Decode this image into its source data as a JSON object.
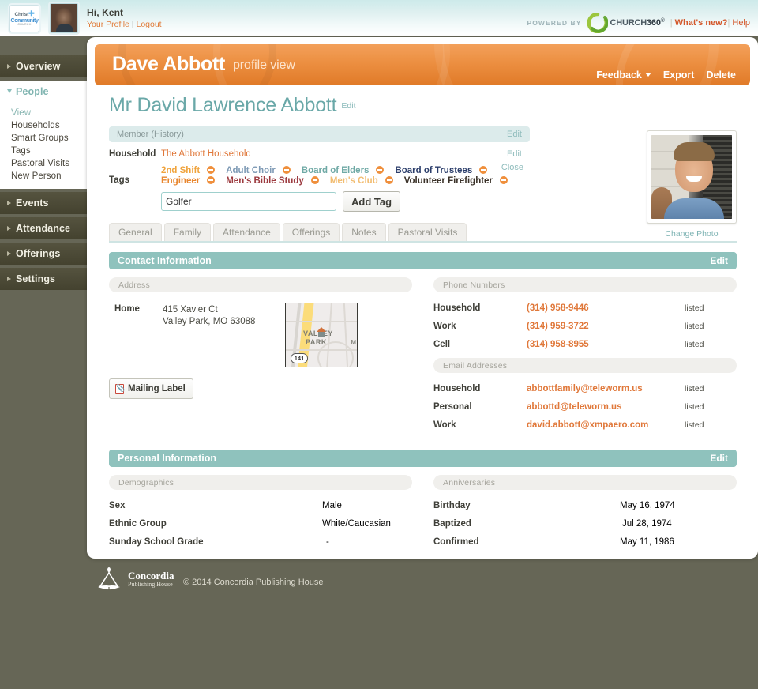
{
  "header": {
    "church_logo": {
      "line1": "Christ",
      "line2": "Community",
      "line3": "CHURCH",
      "cross_icon": "cross-icon"
    },
    "greeting": "Hi, Kent",
    "profile_link": "Your Profile",
    "separator": "|",
    "logout_link": "Logout",
    "powered_by": "POWERED BY",
    "brand": "CHURCH",
    "brand_bold": "360",
    "brand_suffix": "®",
    "bar1": "|",
    "whats_new": "What's new?",
    "bar2": "|",
    "help": "Help"
  },
  "sidebar": {
    "items": [
      {
        "label": "Overview",
        "expanded": false
      },
      {
        "label": "People",
        "expanded": true
      },
      {
        "label": "Events",
        "expanded": false
      },
      {
        "label": "Attendance",
        "expanded": false
      },
      {
        "label": "Offerings",
        "expanded": false
      },
      {
        "label": "Settings",
        "expanded": false
      }
    ],
    "people_sub": [
      {
        "label": "View",
        "active": true
      },
      {
        "label": "Households",
        "active": false
      },
      {
        "label": "Smart Groups",
        "active": false
      },
      {
        "label": "Tags",
        "active": false
      },
      {
        "label": "Pastoral Visits",
        "active": false
      },
      {
        "label": "New Person",
        "active": false
      }
    ]
  },
  "banner": {
    "name": "Dave Abbott",
    "subtitle": "profile view",
    "feedback": "Feedback",
    "export": "Export",
    "delete": "Delete"
  },
  "profile": {
    "full_name": "Mr David Lawrence Abbott",
    "name_edit": "Edit",
    "member_bar_label": "Member (History)",
    "member_bar_edit": "Edit",
    "household_label": "Household",
    "household_value": "The Abbott Household",
    "household_edit": "Edit",
    "household_close": "Close",
    "tags_label": "Tags",
    "tags": [
      {
        "label": "2nd Shift",
        "color": "#f0a33c"
      },
      {
        "label": "Adult Choir",
        "color": "#7e9ab5"
      },
      {
        "label": "Board of Elders",
        "color": "#6fa9a5"
      },
      {
        "label": "Board of Trustees",
        "color": "#2c3e6b"
      },
      {
        "label": "Engineer",
        "color": "#e8862e"
      },
      {
        "label": "Men's Bible Study",
        "color": "#9c3a3f"
      },
      {
        "label": "Men's Club",
        "color": "#f2bd72"
      },
      {
        "label": "Volunteer Firefighter",
        "color": "#3a3128"
      }
    ],
    "tag_input_value": "Golfer",
    "add_tag_button": "Add Tag",
    "change_photo": "Change Photo",
    "photo_alt": "profile-photo"
  },
  "tabs": [
    {
      "label": "General"
    },
    {
      "label": "Family"
    },
    {
      "label": "Attendance"
    },
    {
      "label": "Offerings"
    },
    {
      "label": "Notes"
    },
    {
      "label": "Pastoral Visits"
    }
  ],
  "contact_section": {
    "title": "Contact Information",
    "edit": "Edit",
    "address_header": "Address",
    "address_label": "Home",
    "address_line1": "415 Xavier Ct",
    "address_line2": "Valley Park, MO 63088",
    "map": {
      "label_top": "VALLEY",
      "label_bottom": "PARK",
      "edge_label": "M",
      "route_shield": "141"
    },
    "mailing_label_button": "Mailing Label",
    "phone_header": "Phone Numbers",
    "phones": [
      {
        "type": "Household",
        "number": "(314) 958-9446",
        "status": "listed"
      },
      {
        "type": "Work",
        "number": "(314) 959-3722",
        "status": "listed"
      },
      {
        "type": "Cell",
        "number": "(314) 958-8955",
        "status": "listed"
      }
    ],
    "email_header": "Email Addresses",
    "emails": [
      {
        "type": "Household",
        "address": "abbottfamily@teleworm.us",
        "status": "listed"
      },
      {
        "type": "Personal",
        "address": "abbottd@teleworm.us",
        "status": "listed"
      },
      {
        "type": "Work",
        "address": "david.abbott@xmpaero.com",
        "status": "listed"
      }
    ]
  },
  "personal_section": {
    "title": "Personal Information",
    "edit": "Edit",
    "demographics_header": "Demographics",
    "demographics": [
      {
        "key": "Sex",
        "value": "Male"
      },
      {
        "key": "Ethnic Group",
        "value": "White/Caucasian"
      },
      {
        "key": "Sunday School Grade",
        "value": "-"
      }
    ],
    "anniversaries_header": "Anniversaries",
    "anniversaries": [
      {
        "key": "Birthday",
        "value": "May 16, 1974"
      },
      {
        "key": "Baptized",
        "value": "Jul 28, 1974"
      },
      {
        "key": "Confirmed",
        "value": "May 11, 1986"
      }
    ]
  },
  "footer": {
    "logo_line1": "Concordia",
    "logo_line2": "Publishing House",
    "copyright": "© 2014 Concordia Publishing House"
  },
  "colors": {
    "page_background": "#666656",
    "banner_orange": "#ec8f41",
    "section_teal": "#8fc2bd",
    "link_orange": "#e0783a",
    "sidebar_dark": "#4d4b38"
  }
}
